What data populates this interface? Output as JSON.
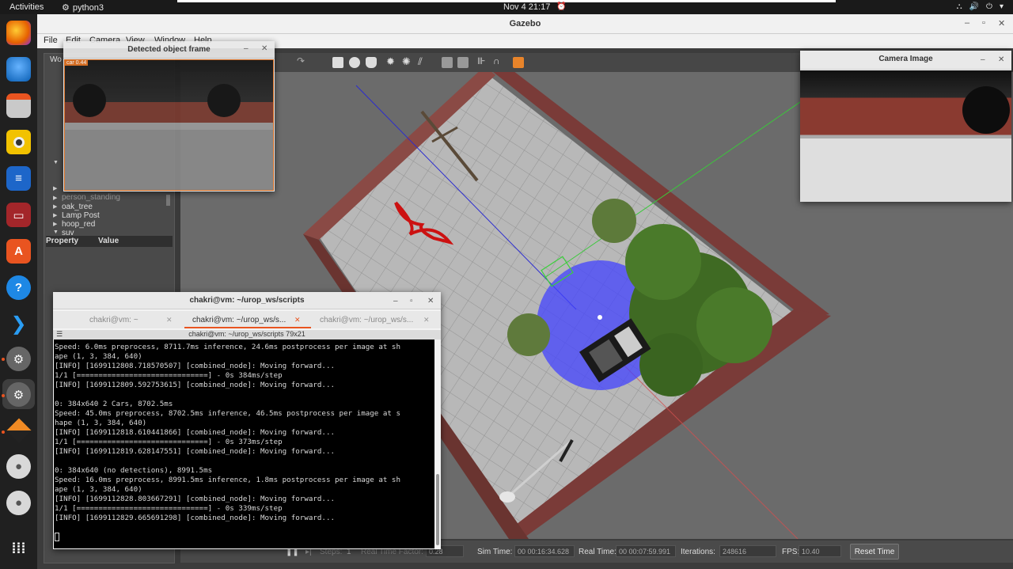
{
  "topbar": {
    "activities": "Activities",
    "app_name": "python3",
    "clock": "Nov 4  21:17"
  },
  "dock": {
    "apps": [
      "firefox-icon",
      "thunderbird-icon",
      "files-icon",
      "rhythmbox-icon",
      "writer-icon",
      "terminal-app-icon",
      "software-icon",
      "help-icon",
      "vscode-icon",
      "settings-icon",
      "settings-icon",
      "gazebo-icon",
      "disc-icon",
      "disc-icon",
      "app-grid-icon"
    ]
  },
  "gazebo": {
    "title": "Gazebo",
    "menu": [
      "File",
      "Edit",
      "Camera",
      "View",
      "Window",
      "Help"
    ],
    "left_panel": {
      "tab_fragment": "Wo",
      "tree_items": [
        "person_standing",
        "oak_tree",
        "Lamp Post",
        "hoop_red",
        "suv"
      ],
      "property_header": "Property",
      "value_header": "Value"
    },
    "bottom_bar": {
      "steps_label": "Steps:",
      "steps_value": "1",
      "rtf_label": "Real Time Factor:",
      "rtf_value": "0.28",
      "sim_time_label": "Sim Time:",
      "sim_time_value": "00 00:16:34.628",
      "real_time_label": "Real Time:",
      "real_time_value": "00 00:07:59.991",
      "iterations_label": "Iterations:",
      "iterations_value": "248616",
      "fps_label": "FPS:",
      "fps_value": "10.40",
      "reset_button": "Reset Time"
    }
  },
  "detected_window": {
    "title": "Detected object frame",
    "detection_label": "car 0.44"
  },
  "camera_window": {
    "title": "Camera Image"
  },
  "terminal": {
    "title": "chakri@vm: ~/urop_ws/scripts",
    "tabs": [
      "chakri@vm: ~",
      "chakri@vm: ~/urop_ws/s...",
      "chakri@vm: ~/urop_ws/s..."
    ],
    "subtitle": "chakri@vm: ~/urop_ws/scripts 79x21",
    "lines": [
      "Speed: 6.0ms preprocess, 8711.7ms inference, 24.6ms postprocess per image at sh",
      "ape (1, 3, 384, 640)",
      "[INFO] [1699112808.718570507] [combined_node]: Moving forward...",
      "1/1 [==============================] - 0s 384ms/step",
      "[INFO] [1699112809.592753615] [combined_node]: Moving forward...",
      "",
      "0: 384x640 2 Cars, 8702.5ms",
      "Speed: 45.0ms preprocess, 8702.5ms inference, 46.5ms postprocess per image at s",
      "hape (1, 3, 384, 640)",
      "[INFO] [1699112818.610441866] [combined_node]: Moving forward...",
      "1/1 [==============================] - 0s 373ms/step",
      "[INFO] [1699112819.628147551] [combined_node]: Moving forward...",
      "",
      "0: 384x640 (no detections), 8991.5ms",
      "Speed: 16.0ms preprocess, 8991.5ms inference, 1.8ms postprocess per image at sh",
      "ape (1, 3, 384, 640)",
      "[INFO] [1699112828.803667291] [combined_node]: Moving forward...",
      "1/1 [==============================] - 0s 339ms/step",
      "[INFO] [1699112829.665691298] [combined_node]: Moving forward...",
      ""
    ]
  },
  "colors": {
    "ubuntu_orange": "#e95420",
    "lidar_blue": "#2222ff",
    "wall_red": "#7a3b38"
  }
}
